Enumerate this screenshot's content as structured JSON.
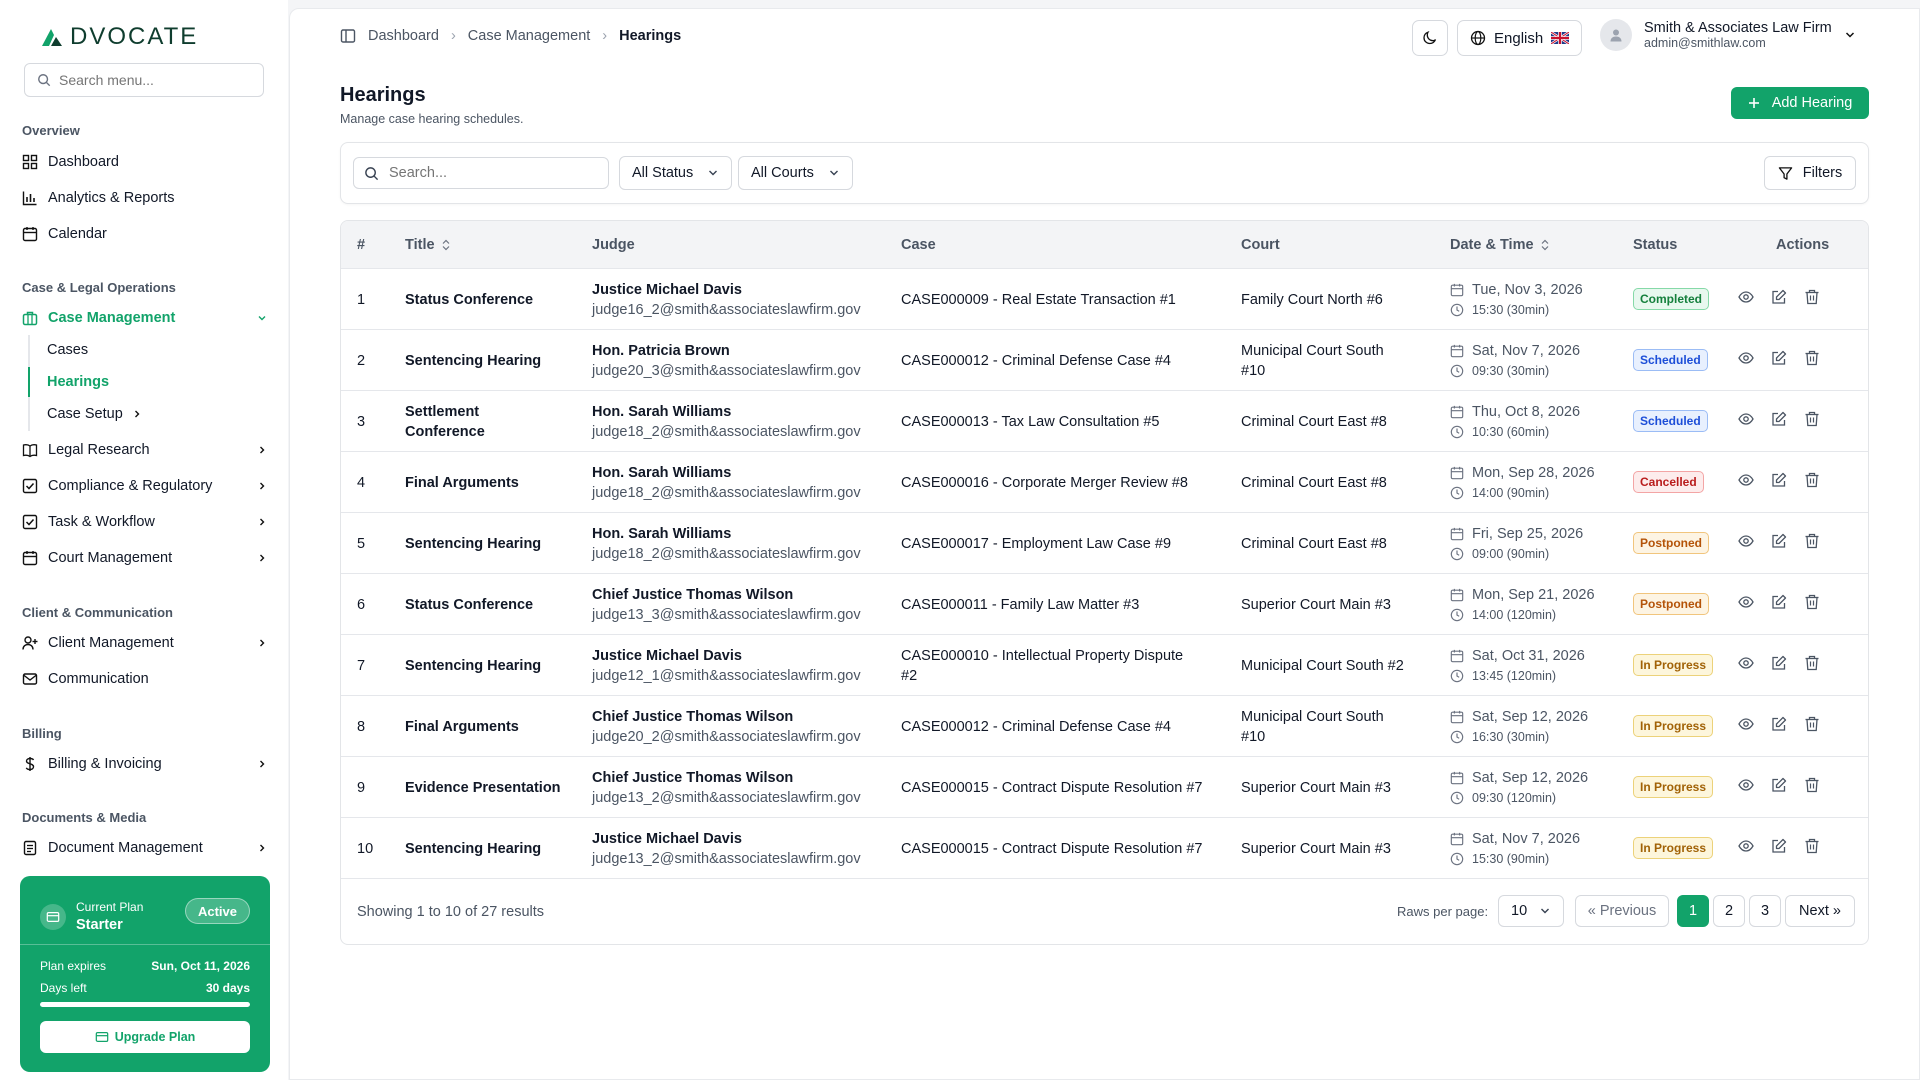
{
  "app": {
    "logo": "DVOCATE"
  },
  "sidebar": {
    "search_placeholder": "Search menu...",
    "sections": [
      "Overview",
      "Case & Legal Operations",
      "Client & Communication",
      "Billing",
      "Documents & Media"
    ],
    "overview": [
      "Dashboard",
      "Analytics & Reports",
      "Calendar"
    ],
    "case_management": "Case Management",
    "sub_items": [
      "Cases",
      "Hearings",
      "Case Setup"
    ],
    "legal_ops": [
      "Legal Research",
      "Compliance & Regulatory",
      "Task & Workflow",
      "Court Management"
    ],
    "client_comm": [
      "Client Management",
      "Communication"
    ],
    "billing": [
      "Billing & Invoicing"
    ],
    "docs": [
      "Document Management"
    ]
  },
  "plan": {
    "label": "Current Plan",
    "name": "Starter",
    "badge": "Active",
    "expires_label": "Plan expires",
    "expires_value": "Sun, Oct 11, 2026",
    "days_label": "Days left",
    "days_value": "30 days",
    "progress": 1.0,
    "upgrade": "Upgrade Plan"
  },
  "topbar": {
    "breadcrumb": [
      "Dashboard",
      "Case Management",
      "Hearings"
    ],
    "language": "English",
    "user_name": "Smith & Associates Law Firm",
    "user_email": "admin@smithlaw.com"
  },
  "page": {
    "title": "Hearings",
    "subtitle": "Manage case hearing schedules.",
    "add_button": "Add Hearing"
  },
  "filters": {
    "search_placeholder": "Search...",
    "status": "All Status",
    "courts": "All Courts",
    "filters_button": "Filters"
  },
  "table": {
    "columns": [
      "#",
      "Title",
      "Judge",
      "Case",
      "Court",
      "Date & Time",
      "Status",
      "Actions"
    ],
    "rows": [
      {
        "num": "1",
        "title": [
          "Status Conference"
        ],
        "judge": "Justice Michael Davis",
        "email": "judge16_2@smith&associateslawfirm.gov",
        "case": [
          "CASE000009 - Real Estate Transaction #1"
        ],
        "court": [
          "Family Court North #6"
        ],
        "date": "Tue, Nov 3, 2026",
        "time": "15:30 (30min)",
        "status": "Completed"
      },
      {
        "num": "2",
        "title": [
          "Sentencing Hearing"
        ],
        "judge": "Hon. Patricia Brown",
        "email": "judge20_3@smith&associateslawfirm.gov",
        "case": [
          "CASE000012 - Criminal Defense Case #4"
        ],
        "court": [
          "Municipal Court South",
          "#10"
        ],
        "date": "Sat, Nov 7, 2026",
        "time": "09:30 (30min)",
        "status": "Scheduled"
      },
      {
        "num": "3",
        "title": [
          "Settlement",
          "Conference"
        ],
        "judge": "Hon. Sarah Williams",
        "email": "judge18_2@smith&associateslawfirm.gov",
        "case": [
          "CASE000013 - Tax Law Consultation #5"
        ],
        "court": [
          "Criminal Court East #8"
        ],
        "date": "Thu, Oct 8, 2026",
        "time": "10:30 (60min)",
        "status": "Scheduled"
      },
      {
        "num": "4",
        "title": [
          "Final Arguments"
        ],
        "judge": "Hon. Sarah Williams",
        "email": "judge18_2@smith&associateslawfirm.gov",
        "case": [
          "CASE000016 - Corporate Merger Review #8"
        ],
        "court": [
          "Criminal Court East #8"
        ],
        "date": "Mon, Sep 28, 2026",
        "time": "14:00 (90min)",
        "status": "Cancelled"
      },
      {
        "num": "5",
        "title": [
          "Sentencing Hearing"
        ],
        "judge": "Hon. Sarah Williams",
        "email": "judge18_2@smith&associateslawfirm.gov",
        "case": [
          "CASE000017 - Employment Law Case #9"
        ],
        "court": [
          "Criminal Court East #8"
        ],
        "date": "Fri, Sep 25, 2026",
        "time": "09:00 (90min)",
        "status": "Postponed"
      },
      {
        "num": "6",
        "title": [
          "Status Conference"
        ],
        "judge": "Chief Justice Thomas Wilson",
        "email": "judge13_3@smith&associateslawfirm.gov",
        "case": [
          "CASE000011 - Family Law Matter #3"
        ],
        "court": [
          "Superior Court Main #3"
        ],
        "date": "Mon, Sep 21, 2026",
        "time": "14:00 (120min)",
        "status": "Postponed"
      },
      {
        "num": "7",
        "title": [
          "Sentencing Hearing"
        ],
        "judge": "Justice Michael Davis",
        "email": "judge12_1@smith&associateslawfirm.gov",
        "case": [
          "CASE000010 - Intellectual Property Dispute",
          "#2"
        ],
        "court": [
          "Municipal Court South #2"
        ],
        "date": "Sat, Oct 31, 2026",
        "time": "13:45 (120min)",
        "status": "In Progress"
      },
      {
        "num": "8",
        "title": [
          "Final Arguments"
        ],
        "judge": "Chief Justice Thomas Wilson",
        "email": "judge20_2@smith&associateslawfirm.gov",
        "case": [
          "CASE000012 - Criminal Defense Case #4"
        ],
        "court": [
          "Municipal Court South",
          "#10"
        ],
        "date": "Sat, Sep 12, 2026",
        "time": "16:30 (30min)",
        "status": "In Progress"
      },
      {
        "num": "9",
        "title": [
          "Evidence Presentation"
        ],
        "judge": "Chief Justice Thomas Wilson",
        "email": "judge13_2@smith&associateslawfirm.gov",
        "case": [
          "CASE000015 - Contract Dispute Resolution #7"
        ],
        "court": [
          "Superior Court Main #3"
        ],
        "date": "Sat, Sep 12, 2026",
        "time": "09:30 (120min)",
        "status": "In Progress"
      },
      {
        "num": "10",
        "title": [
          "Sentencing Hearing"
        ],
        "judge": "Justice Michael Davis",
        "email": "judge13_2@smith&associateslawfirm.gov",
        "case": [
          "CASE000015 - Contract Dispute Resolution #7"
        ],
        "court": [
          "Superior Court Main #3"
        ],
        "date": "Sat, Nov 7, 2026",
        "time": "15:30 (90min)",
        "status": "In Progress"
      }
    ]
  },
  "status_colors": {
    "Completed": {
      "bg": "#e8f8ef",
      "fg": "#15803d",
      "border": "#86d9a8"
    },
    "Scheduled": {
      "bg": "#e8f0fe",
      "fg": "#1d4ed8",
      "border": "#9bbcf5"
    },
    "Cancelled": {
      "bg": "#fdecec",
      "fg": "#b91c1c",
      "border": "#f3a5a5"
    },
    "Postponed": {
      "bg": "#fdf4e3",
      "fg": "#b45309",
      "border": "#f1c57d"
    },
    "In Progress": {
      "bg": "#fdf6dc",
      "fg": "#a16207",
      "border": "#ecd27a"
    }
  },
  "footer": {
    "showing": "Showing 1 to 10 of 27 results",
    "rows_label": "Raws per page:",
    "rows_value": "10",
    "prev": "« Previous",
    "pages": [
      "1",
      "2",
      "3"
    ],
    "next": "Next »"
  },
  "theme": {
    "accent": "#12a36a"
  }
}
